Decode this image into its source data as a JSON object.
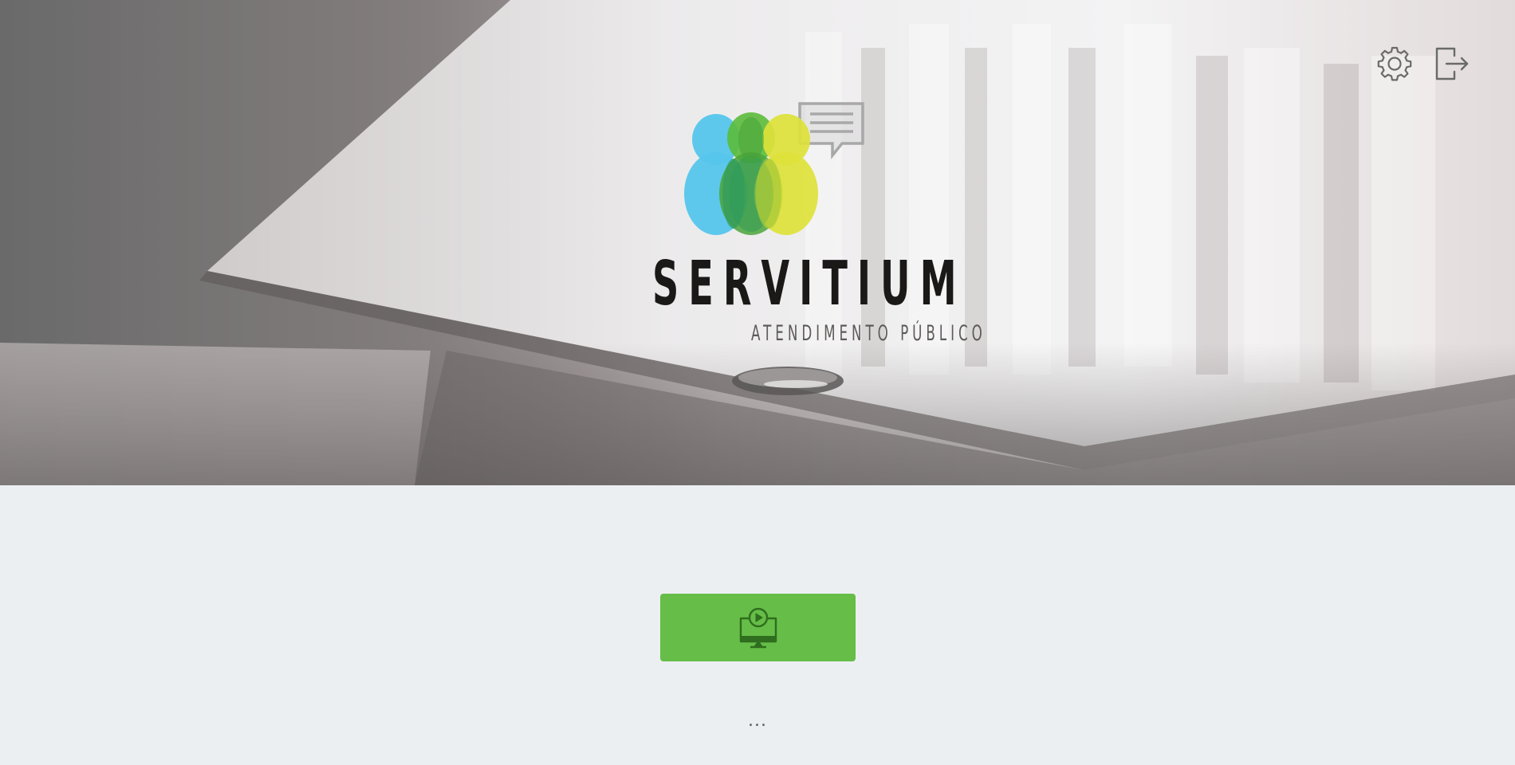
{
  "header": {
    "settings_icon": "gear-icon",
    "logout_icon": "logout-icon"
  },
  "logo": {
    "title": "SERVITIUM",
    "subtitle": "ATENDIMENTO PÚBLICO",
    "mark_icon": "three-people-chat-bubble-logo",
    "colors": {
      "blue": "#55c6ec",
      "green": "#6cbf3f",
      "yellow": "#dde23a",
      "bubble": "#a8a8a8"
    }
  },
  "main": {
    "display_button_icon": "monitor-play-icon",
    "display_button_color": "#66be48",
    "loading_text": "..."
  },
  "colors": {
    "page_background": "#eceff2",
    "title_text": "#1b1918",
    "subtitle_text": "#5e5a5a"
  }
}
